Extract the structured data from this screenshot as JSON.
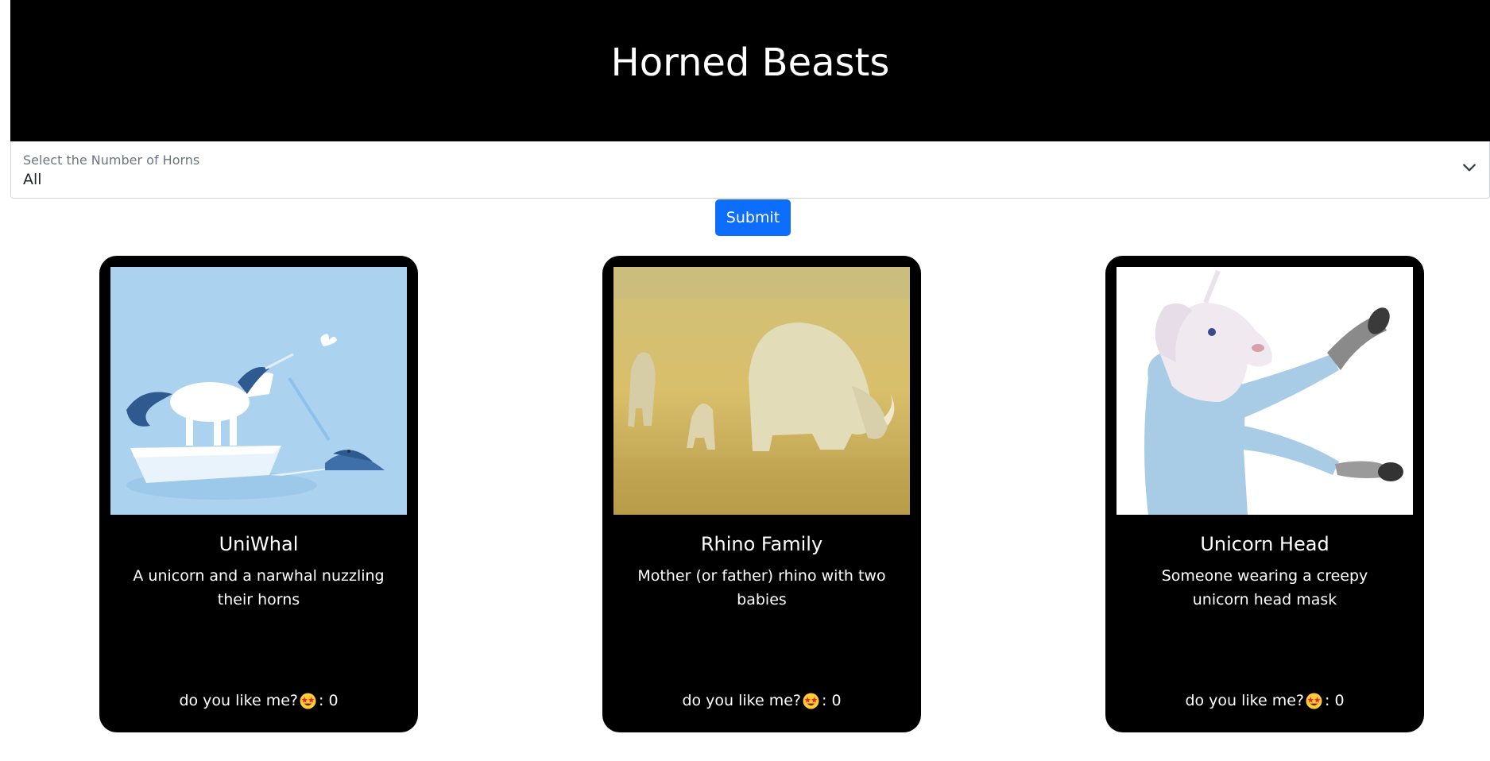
{
  "header": {
    "title": "Horned Beasts"
  },
  "filter": {
    "label": "Select the Number of Horns",
    "selected": "All"
  },
  "submit": {
    "label": "Submit"
  },
  "cards": [
    {
      "title": "UniWhal",
      "description": "A unicorn and a narwhal nuzzling their horns",
      "like_prompt": "do you like me?",
      "like_count": ": 0"
    },
    {
      "title": "Rhino Family",
      "description": "Mother (or father) rhino with two babies",
      "like_prompt": "do you like me?",
      "like_count": ": 0"
    },
    {
      "title": "Unicorn Head",
      "description": "Someone wearing a creepy unicorn head mask",
      "like_prompt": "do you like me?",
      "like_count": ": 0"
    }
  ],
  "icons": {
    "like": "star-struck-emoji-icon",
    "dropdown": "chevron-down-icon"
  },
  "colors": {
    "header_bg": "#000000",
    "card_bg": "#000000",
    "button_bg": "#0d6efd"
  }
}
